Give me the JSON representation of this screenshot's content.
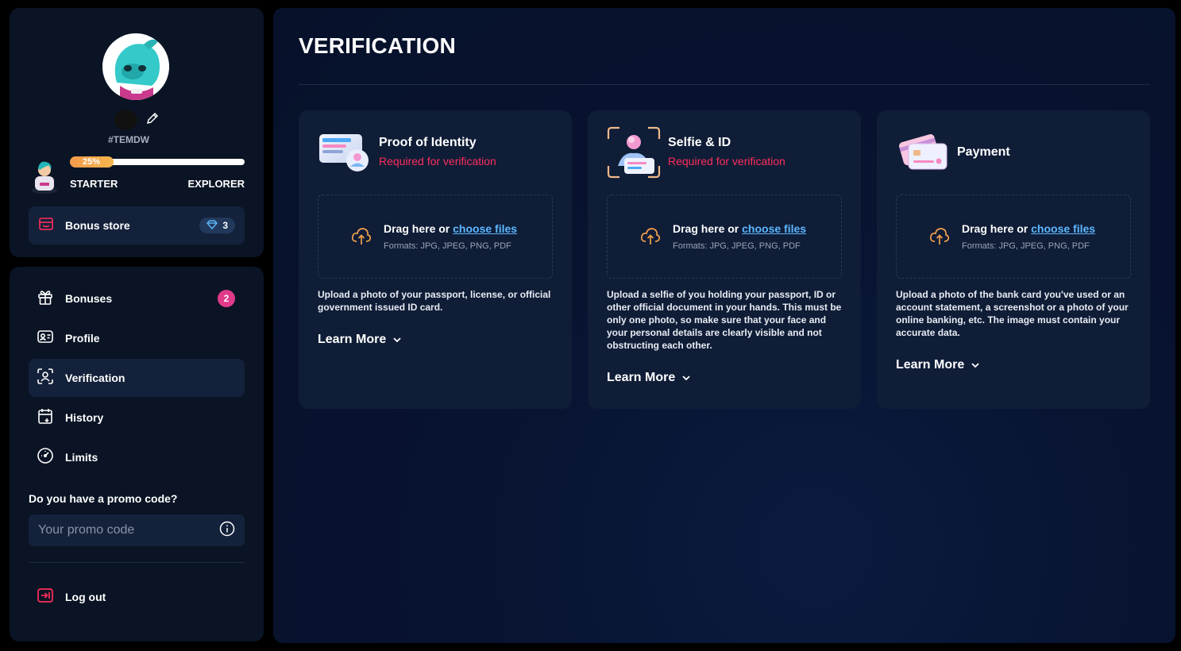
{
  "profile": {
    "nickname_id": "#TEMDW",
    "progress_percent": 25,
    "progress_label": "25%",
    "level_start": "STARTER",
    "level_end": "EXPLORER",
    "bonus_store": {
      "label": "Bonus store",
      "gems": "3"
    }
  },
  "nav": {
    "items": [
      {
        "label": "Bonuses",
        "icon": "gift-icon",
        "badge": "2"
      },
      {
        "label": "Profile",
        "icon": "id-card-icon"
      },
      {
        "label": "Verification",
        "icon": "face-scan-icon",
        "active": true
      },
      {
        "label": "History",
        "icon": "calendar-icon"
      },
      {
        "label": "Limits",
        "icon": "gauge-icon"
      }
    ],
    "promo_question": "Do you have a promo code?",
    "promo_placeholder": "Your promo code",
    "logout": "Log out"
  },
  "main": {
    "title": "VERIFICATION",
    "cards": [
      {
        "title": "Proof of Identity",
        "subtitle": "Required for verification",
        "drag_text": "Drag here or ",
        "choose_link": "choose files",
        "formats": "Formats: JPG, JPEG, PNG, PDF",
        "description": "Upload a photo of your passport, license, or official government issued ID card.",
        "learn_more": "Learn More"
      },
      {
        "title": "Selfie & ID",
        "subtitle": "Required for verification",
        "drag_text": "Drag here or ",
        "choose_link": "choose files",
        "formats": "Formats: JPG, JPEG, PNG, PDF",
        "description": "Upload a selfie of you holding your passport, ID or other official document in your hands. This must be only one photo, so make sure that your face and your personal details are clearly visible and not obstructing each other.",
        "learn_more": "Learn More"
      },
      {
        "title": "Payment",
        "drag_text": "Drag here or ",
        "choose_link": "choose files",
        "formats": "Formats: JPG, JPEG, PNG, PDF",
        "description": "Upload a photo of the bank card you've used or an account statement, a screenshot or a photo of your online banking, etc. The image must contain your accurate data.",
        "learn_more": "Learn More"
      }
    ]
  },
  "colors": {
    "accent_link": "#5db7ff",
    "required_red": "#ff2d5c",
    "badge_pink": "#e03a8a",
    "upload_orange": "#f2a04c"
  }
}
